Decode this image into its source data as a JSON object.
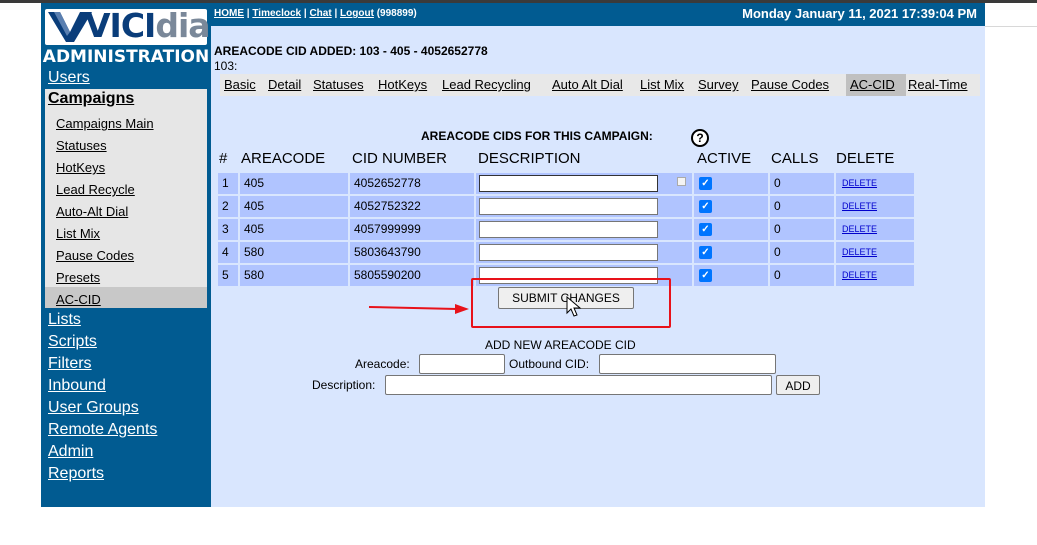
{
  "header": {
    "links": [
      "HOME",
      "Timeclock",
      "Chat",
      "Logout"
    ],
    "user_id": "(998899)",
    "datetime": "Monday January 11, 2021 17:39:04 PM"
  },
  "sidebar": {
    "logo_part1": "VICI",
    "logo_part2": "dial",
    "title": "ADMINISTRATION",
    "users": "Users",
    "campaigns": "Campaigns",
    "campaign_sub": [
      "Campaigns Main",
      "Statuses",
      "HotKeys",
      "Lead Recycle",
      "Auto-Alt Dial",
      "List Mix",
      "Pause Codes",
      "Presets",
      "AC-CID"
    ],
    "links_after": [
      "Lists",
      "Scripts",
      "Filters",
      "Inbound",
      "User Groups",
      "Remote Agents",
      "Admin",
      "Reports"
    ]
  },
  "main": {
    "message": "AREACODE CID ADDED: 103 - 405 - 4052652778",
    "message2": "103:",
    "tabs": [
      "Basic",
      "Detail",
      "Statuses",
      "HotKeys",
      "Lead Recycling",
      "Auto Alt Dial",
      "List Mix",
      "Survey",
      "Pause Codes",
      "AC-CID",
      "Real-Time"
    ],
    "active_tab": "AC-CID",
    "section_title": "AREACODE CIDS FOR THIS CAMPAIGN:",
    "help_icon": "?",
    "columns": [
      "#",
      "AREACODE",
      "CID NUMBER",
      "DESCRIPTION",
      "ACTIVE",
      "CALLS",
      "DELETE"
    ],
    "rows": [
      {
        "num": "1",
        "areacode": "405",
        "cid": "4052652778",
        "description": "",
        "active": true,
        "calls": "0",
        "delete": "DELETE"
      },
      {
        "num": "2",
        "areacode": "405",
        "cid": "4052752322",
        "description": "",
        "active": true,
        "calls": "0",
        "delete": "DELETE"
      },
      {
        "num": "3",
        "areacode": "405",
        "cid": "4057999999",
        "description": "",
        "active": true,
        "calls": "0",
        "delete": "DELETE"
      },
      {
        "num": "4",
        "areacode": "580",
        "cid": "5803643790",
        "description": "",
        "active": true,
        "calls": "0",
        "delete": "DELETE"
      },
      {
        "num": "5",
        "areacode": "580",
        "cid": "5805590200",
        "description": "",
        "active": true,
        "calls": "0",
        "delete": "DELETE"
      }
    ],
    "submit_label": "SUBMIT CHANGES",
    "add": {
      "title": "ADD NEW AREACODE CID",
      "areacode_label": "Areacode:",
      "outbound_label": "Outbound CID:",
      "description_label": "Description:",
      "add_button": "ADD"
    }
  },
  "colors": {
    "nav_blue": "#015b91",
    "main_bg": "#d9e6fe",
    "row_bg": "#b0c4ff",
    "highlight_red": "#e8121a"
  }
}
